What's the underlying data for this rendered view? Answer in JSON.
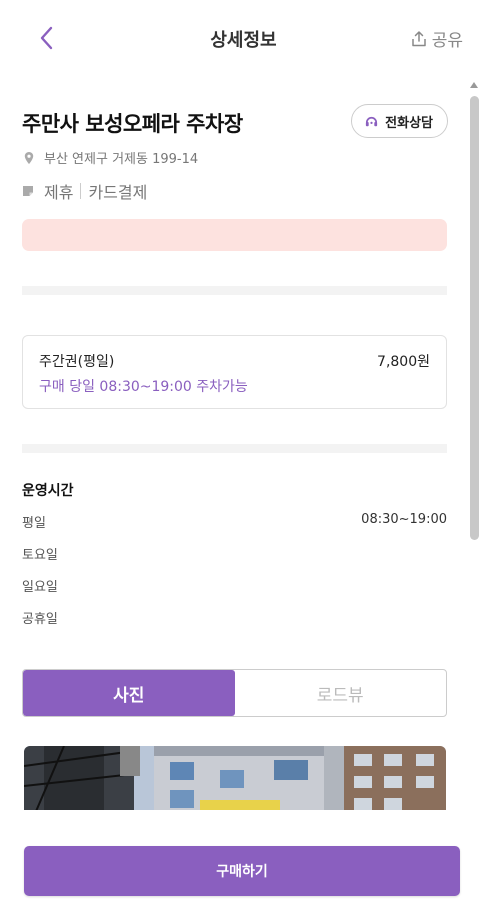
{
  "header": {
    "title": "상세정보",
    "share_label": "공유"
  },
  "place": {
    "name": "주만사 보성오페라 주차장",
    "call_label": "전화상담",
    "address": "부산 연제구 거제동 199-14",
    "tags": [
      "제휴",
      "카드결제"
    ]
  },
  "ticket": {
    "name": "주간권(평일)",
    "price": "7,800원",
    "note": "구매 당일 08:30~19:00 주차가능"
  },
  "hours": {
    "title": "운영시간",
    "rows": [
      {
        "day": "평일",
        "time": "08:30~19:00"
      },
      {
        "day": "토요일",
        "time": ""
      },
      {
        "day": "일요일",
        "time": ""
      },
      {
        "day": "공휴일",
        "time": ""
      }
    ]
  },
  "tabs": [
    {
      "label": "사진",
      "active": true
    },
    {
      "label": "로드뷰",
      "active": false
    }
  ],
  "footer": {
    "buy_label": "구매하기"
  },
  "colors": {
    "accent": "#8a5fbf",
    "alert_bg": "#fde2df"
  },
  "icons": {
    "back": "chevron-left-icon",
    "share": "share-icon",
    "call": "headset-icon",
    "location": "map-pin-icon",
    "tag": "tag-icon"
  }
}
